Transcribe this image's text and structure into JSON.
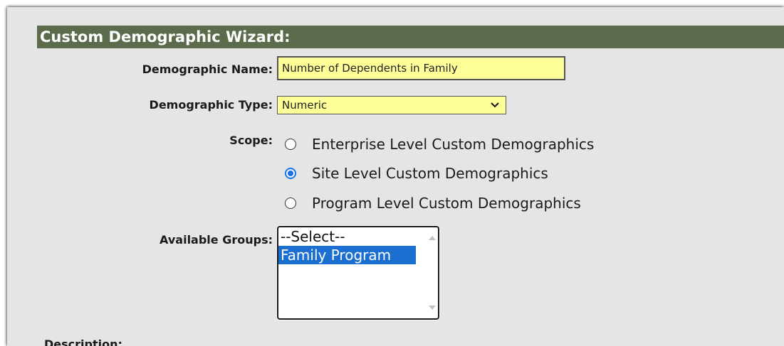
{
  "wizard": {
    "title": "Custom Demographic Wizard:"
  },
  "form": {
    "name_label": "Demographic Name:",
    "name_value": "Number of Dependents in Family",
    "type_label": "Demographic Type:",
    "type_value": "Numeric",
    "scope_label": "Scope:",
    "scope_options": [
      {
        "label": "Enterprise Level Custom Demographics",
        "checked": false
      },
      {
        "label": "Site Level Custom Demographics",
        "checked": true
      },
      {
        "label": "Program Level Custom Demographics",
        "checked": false
      }
    ],
    "groups_label": "Available Groups:",
    "groups_options": [
      {
        "label": "--Select--",
        "selected": false
      },
      {
        "label": "Family Program",
        "selected": true
      }
    ],
    "description_label": "Description:"
  },
  "colors": {
    "header_bg": "#5b6b4b",
    "field_bg": "#ffff99",
    "panel_bg": "#e5e5e5",
    "radio_accent": "#1a73e8",
    "selection_bg": "#1a6fd1"
  }
}
